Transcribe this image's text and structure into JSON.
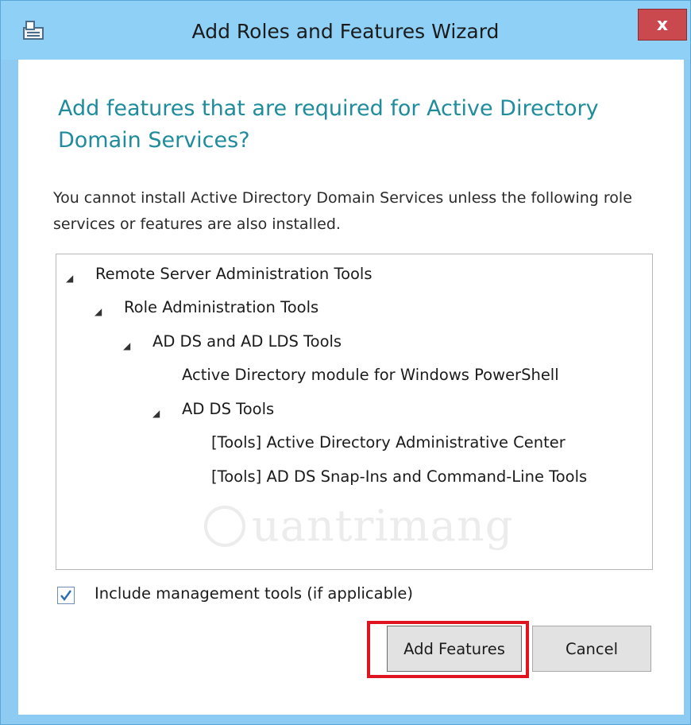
{
  "window": {
    "title": "Add Roles and Features Wizard",
    "close_label": "x"
  },
  "dialog": {
    "heading": "Add features that are required for Active Directory Domain Services?",
    "description": "You cannot install Active Directory Domain Services unless the following role services or features are also installed."
  },
  "tree": {
    "items": [
      {
        "label": "Remote Server Administration Tools",
        "expanded": true
      },
      {
        "label": "Role Administration Tools",
        "expanded": true
      },
      {
        "label": "AD DS and AD LDS Tools",
        "expanded": true
      },
      {
        "label": "Active Directory module for Windows PowerShell",
        "expanded": false
      },
      {
        "label": "AD DS Tools",
        "expanded": true
      },
      {
        "label": "[Tools] Active Directory Administrative Center",
        "expanded": false
      },
      {
        "label": "[Tools] AD DS Snap-Ins and Command-Line Tools",
        "expanded": false
      }
    ],
    "expander_glyph": "◢"
  },
  "watermark": "uantrimang",
  "options": {
    "include_tools_label": "Include management tools (if applicable)",
    "include_tools_checked": true
  },
  "buttons": {
    "add_features": "Add Features",
    "cancel": "Cancel"
  },
  "colors": {
    "heading": "#1e8c9c",
    "titlebar": "#8fd0f6",
    "close": "#c9494e",
    "highlight": "#e0141e"
  }
}
